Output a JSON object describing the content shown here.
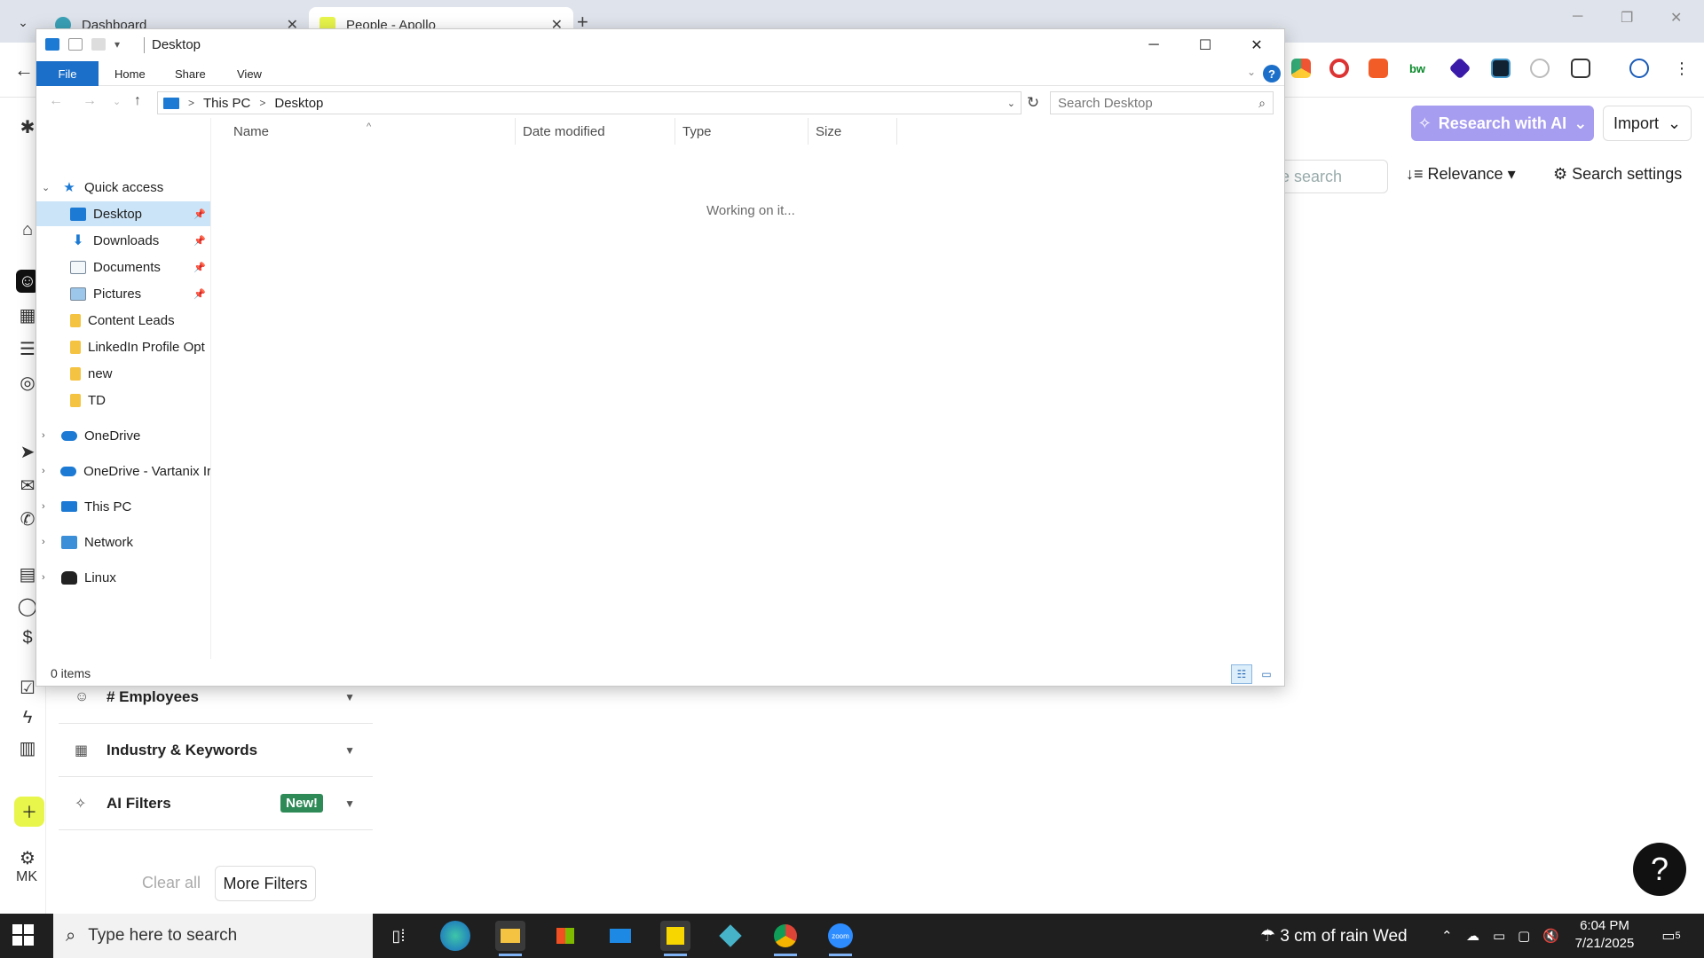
{
  "browser": {
    "tabs": [
      {
        "title": "Dashboard",
        "close": "✕"
      },
      {
        "title": "People - Apollo",
        "close": "✕"
      }
    ],
    "new_tab": "+",
    "tab_menu": "⌄"
  },
  "apollo": {
    "research_button": "Research with AI",
    "import_button": "Import",
    "save_search_fragment": "e search",
    "sort_label": "Relevance",
    "search_settings": "Search settings",
    "filters": [
      {
        "label": "# Employees"
      },
      {
        "label": "Industry & Keywords"
      },
      {
        "label": "AI Filters",
        "badge": "New!"
      }
    ],
    "clear_all": "Clear all",
    "more_filters": "More Filters",
    "avatar_initials": "MK",
    "help": "?"
  },
  "explorer": {
    "title": "Desktop",
    "ribbon_tabs": [
      "File",
      "Home",
      "Share",
      "View"
    ],
    "breadcrumb": [
      "This PC",
      "Desktop"
    ],
    "search_placeholder": "Search Desktop",
    "nav": {
      "quick_access": "Quick access",
      "pinned": [
        "Desktop",
        "Downloads",
        "Documents",
        "Pictures"
      ],
      "folders": [
        "Content Leads",
        "LinkedIn Profile Opt",
        "new",
        "TD"
      ],
      "roots": [
        "OneDrive",
        "OneDrive - Vartanix Ir",
        "This PC",
        "Network",
        "Linux"
      ]
    },
    "columns": [
      "Name",
      "Date modified",
      "Type",
      "Size"
    ],
    "status_message": "Working on it...",
    "item_count": "0 items"
  },
  "taskbar": {
    "search_placeholder": "Type here to search",
    "weather": "3 cm of rain Wed",
    "time": "6:04 PM",
    "date": "7/21/2025",
    "notification_count": "5"
  }
}
